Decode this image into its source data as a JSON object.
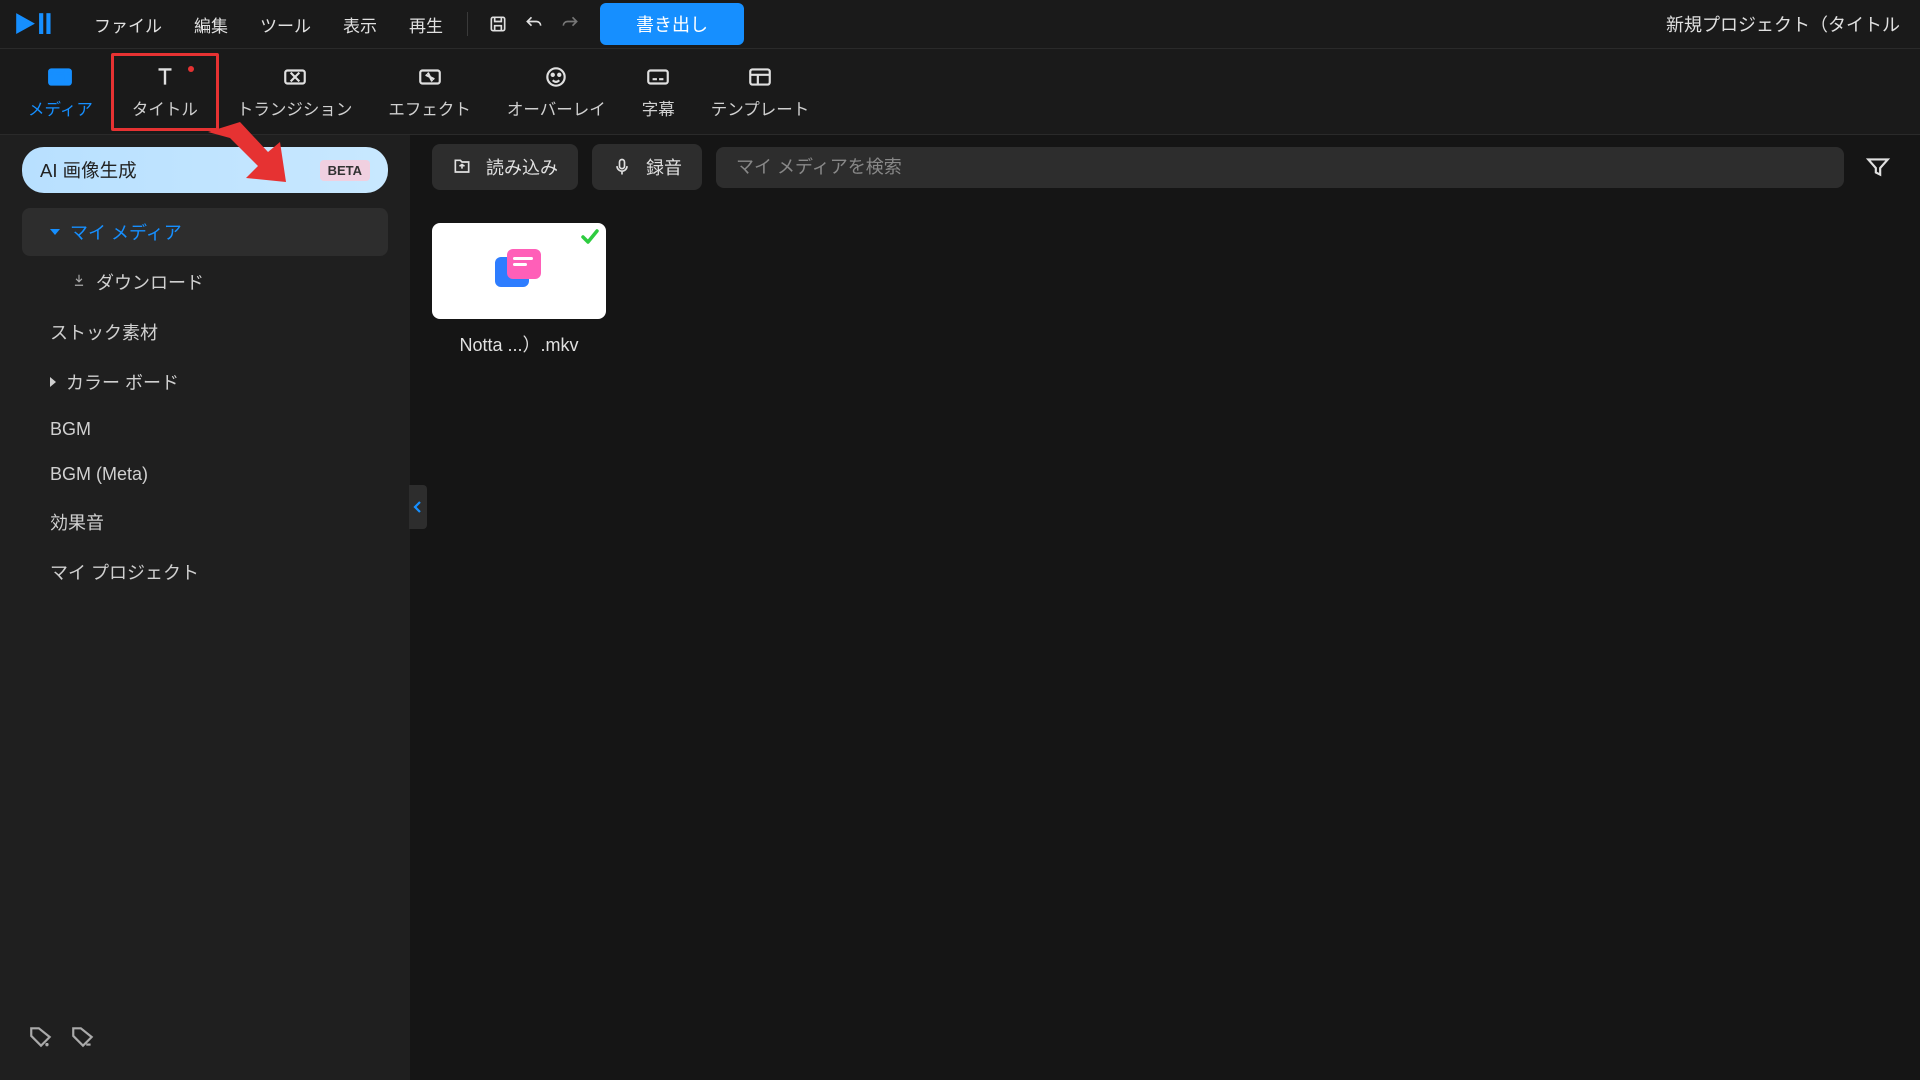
{
  "menubar": {
    "items": [
      "ファイル",
      "編集",
      "ツール",
      "表示",
      "再生"
    ],
    "export": "書き出し",
    "project_title": "新規プロジェクト（タイトル"
  },
  "categories": [
    {
      "label": "メディア",
      "icon": "media"
    },
    {
      "label": "タイトル",
      "icon": "title"
    },
    {
      "label": "トランジション",
      "icon": "transition"
    },
    {
      "label": "エフェクト",
      "icon": "effect"
    },
    {
      "label": "オーバーレイ",
      "icon": "overlay"
    },
    {
      "label": "字幕",
      "icon": "subtitle"
    },
    {
      "label": "テンプレート",
      "icon": "template"
    }
  ],
  "sidebar": {
    "ai_button": "AI 画像生成",
    "beta": "BETA",
    "items": [
      {
        "label": "マイ メディア",
        "expandable": true,
        "open": true,
        "active": true
      },
      {
        "label": "ダウンロード",
        "sub": true,
        "dl": true
      },
      {
        "label": "ストック素材"
      },
      {
        "label": "カラー ボード",
        "expandable": true
      },
      {
        "label": "BGM"
      },
      {
        "label": "BGM (Meta)"
      },
      {
        "label": "効果音"
      },
      {
        "label": "マイ プロジェクト"
      }
    ]
  },
  "toolbar": {
    "import": "読み込み",
    "record": "録音",
    "search_placeholder": "マイ メディアを検索"
  },
  "media": [
    {
      "name": "Notta ...）.mkv"
    }
  ]
}
